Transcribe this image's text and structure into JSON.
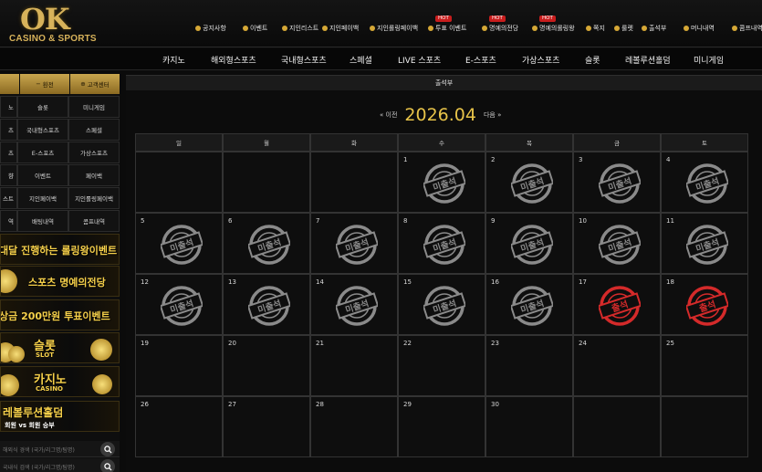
{
  "logo": {
    "big": "OK",
    "small": "CASINO & SPORTS"
  },
  "topnav": [
    {
      "label": "공지사항",
      "hot": ""
    },
    {
      "label": "이벤트",
      "hot": ""
    },
    {
      "label": "지인리스트",
      "hot": ""
    },
    {
      "label": "지인페이백",
      "hot": ""
    },
    {
      "label": "지인롤링페이백",
      "hot": ""
    },
    {
      "label": "투표 이벤트",
      "hot": "HOT"
    },
    {
      "label": "명예의전당",
      "hot": "HOT"
    },
    {
      "label": "명예의롤링왕",
      "hot": "HOT"
    },
    {
      "label": "쪽지",
      "hot": ""
    },
    {
      "label": "룰렛",
      "hot": ""
    },
    {
      "label": "출석부",
      "hot": ""
    },
    {
      "label": "머니내역",
      "hot": ""
    },
    {
      "label": "콤프내역",
      "hot": ""
    }
  ],
  "mainmenu": [
    "카지노",
    "해외형스포츠",
    "국내형스포츠",
    "스페셜",
    "LIVE 스포츠",
    "E-스포츠",
    "가상스포츠",
    "슬롯",
    "레볼루션홀덤",
    "미니게임"
  ],
  "sidebar": {
    "tabs": [
      "",
      "환전",
      "고객센터"
    ],
    "grid": [
      [
        "노",
        "슬롯",
        "미니게임"
      ],
      [
        "츠",
        "국내형스포츠",
        "스페셜"
      ],
      [
        "츠",
        "E-스포츠",
        "가상스포츠"
      ],
      [
        "향",
        "이벤트",
        "페이백"
      ],
      [
        "스트",
        "지인페이백",
        "지인롤링페이백"
      ],
      [
        "역",
        "배팅내역",
        "콤프내역"
      ]
    ],
    "banners": [
      {
        "text": "대달 진행하는 롤링왕이벤트",
        "sub": ""
      },
      {
        "text": "스포츠 명예의전당",
        "sub": ""
      },
      {
        "text": "상금 200만원 투표이벤트",
        "sub": ""
      },
      {
        "text": "슬롯",
        "sub": "SLOT"
      },
      {
        "text": "카지노",
        "sub": "CASINO"
      },
      {
        "text": "레볼루션홀덤",
        "sub": "회원 vs 회원 승부"
      }
    ],
    "search": [
      "해외식 경색 (국가/리그명/팀명)",
      "국내식 검색 (국가/리그명/팀명)"
    ]
  },
  "panel": {
    "title": "출석부"
  },
  "calendar": {
    "prev": "« 이전",
    "title": "2026.04",
    "next": "다음 »",
    "weekdays": [
      "일",
      "월",
      "화",
      "수",
      "목",
      "금",
      "토"
    ],
    "weeks": [
      [
        {
          "day": ""
        },
        {
          "day": ""
        },
        {
          "day": ""
        },
        {
          "day": "1",
          "stamp": "absent"
        },
        {
          "day": "2",
          "stamp": "absent"
        },
        {
          "day": "3",
          "stamp": "absent"
        },
        {
          "day": "4",
          "stamp": "absent"
        }
      ],
      [
        {
          "day": "5",
          "stamp": "absent"
        },
        {
          "day": "6",
          "stamp": "absent"
        },
        {
          "day": "7",
          "stamp": "absent"
        },
        {
          "day": "8",
          "stamp": "absent"
        },
        {
          "day": "9",
          "stamp": "absent"
        },
        {
          "day": "10",
          "stamp": "absent"
        },
        {
          "day": "11",
          "stamp": "absent"
        }
      ],
      [
        {
          "day": "12",
          "stamp": "absent"
        },
        {
          "day": "13",
          "stamp": "absent"
        },
        {
          "day": "14",
          "stamp": "absent"
        },
        {
          "day": "15",
          "stamp": "absent"
        },
        {
          "day": "16",
          "stamp": "absent"
        },
        {
          "day": "17",
          "stamp": "present"
        },
        {
          "day": "18",
          "stamp": "present"
        }
      ],
      [
        {
          "day": "19"
        },
        {
          "day": "20"
        },
        {
          "day": "21"
        },
        {
          "day": "22"
        },
        {
          "day": "23"
        },
        {
          "day": "24"
        },
        {
          "day": "25"
        }
      ],
      [
        {
          "day": "26"
        },
        {
          "day": "27"
        },
        {
          "day": "28"
        },
        {
          "day": "29"
        },
        {
          "day": "30"
        },
        {
          "day": ""
        },
        {
          "day": ""
        }
      ]
    ],
    "stamp_text": {
      "absent": "미출석",
      "present": "출석"
    },
    "colors": {
      "absent": "#8a8a8a",
      "present": "#d42a2a",
      "accent": "#e7c349"
    }
  }
}
